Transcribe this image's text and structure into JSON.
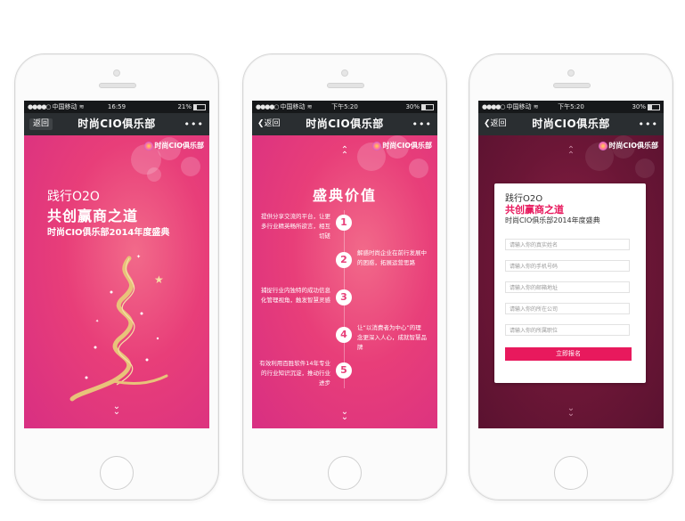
{
  "status": {
    "carrier": "中国移动",
    "phone1": {
      "time": "16:59",
      "battery": "21%"
    },
    "phone2": {
      "time": "下午5:20",
      "battery": "30%"
    },
    "phone3": {
      "time": "下午5:20",
      "battery": "30%"
    }
  },
  "nav": {
    "back_boxed": "返回",
    "back": "返回",
    "title": "时尚CIO俱乐部",
    "more": "•••"
  },
  "logo_text": "时尚CIO俱乐部",
  "screen1": {
    "line1": "践行O2O",
    "line2": "共创赢商之道",
    "line3": "时尚CIO俱乐部2014年度盛典"
  },
  "screen2": {
    "title": "盛典价值",
    "items": [
      {
        "num": "1",
        "text": "提供分享交流的平台，让更多行业精英畅所欲言，相互切磋"
      },
      {
        "num": "2",
        "text": "解惑时尚企业在前行发展中的困惑，拓展运营思路"
      },
      {
        "num": "3",
        "text": "捕捉行业内独特的成功信息化管理视角，触发智慧灵感"
      },
      {
        "num": "4",
        "text": "让“以消费者为中心”的理念更深入人心，成就智慧品牌"
      },
      {
        "num": "5",
        "text": "有效利用百胜软件14年专业的行业知识沉淀，推动行业进步"
      }
    ]
  },
  "screen3": {
    "line1": "践行O2O",
    "line2": "共创赢商之道",
    "line3": "时尚CIO俱乐部2014年度盛典",
    "fields": [
      "请输入你的真实姓名",
      "请输入你的手机号码",
      "请输入你的邮箱地址",
      "请输入你的所在公司",
      "请输入你的所属职位"
    ],
    "submit": "立即报名"
  },
  "colors": {
    "pink": "#e83e79",
    "wine": "#6b1636",
    "accent": "#e8195d",
    "navbar": "#2a2e31",
    "statusbar": "#16181a"
  },
  "icons": [
    "signal-icon",
    "wifi-icon",
    "battery-icon",
    "back-arrow-icon",
    "more-icon",
    "chevron-up-icon",
    "chevron-down-icon",
    "christmas-tree-illustration"
  ]
}
